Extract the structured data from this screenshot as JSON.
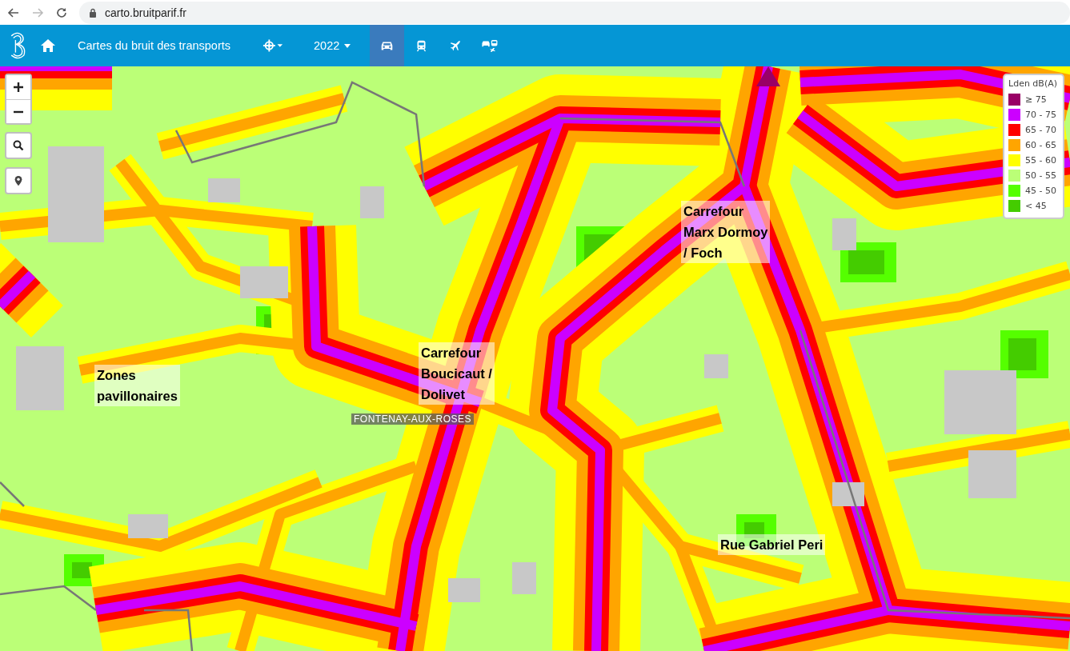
{
  "browser": {
    "url": "carto.bruitparif.fr"
  },
  "navbar": {
    "title": "Cartes du bruit des transports",
    "year": "2022",
    "modes": [
      {
        "kind": "car",
        "selected": true
      },
      {
        "kind": "train",
        "selected": false
      },
      {
        "kind": "plane",
        "selected": false
      },
      {
        "kind": "multi",
        "selected": false
      }
    ]
  },
  "map": {
    "place_label": "FONTENAY-AUX-ROSES",
    "annotations": [
      "Carrefour\nMarx Dormoy\n/ Foch",
      "Zones\npavillonaires",
      "Carrefour\nBoucicaut /\nDolivet",
      "Rue Gabriel Peri"
    ],
    "legend": {
      "title": "Lden dB(A)",
      "items": [
        {
          "label": "≥ 75",
          "color": "#990066"
        },
        {
          "label": "70 - 75",
          "color": "#cc00ff"
        },
        {
          "label": "65 - 70",
          "color": "#ff0000"
        },
        {
          "label": "60 - 65",
          "color": "#ffa500"
        },
        {
          "label": "55 - 60",
          "color": "#ffff00"
        },
        {
          "label": "50 - 55",
          "color": "#bbff77"
        },
        {
          "label": "45 - 50",
          "color": "#55ff00"
        },
        {
          "label": "< 45",
          "color": "#44cc00"
        }
      ]
    }
  }
}
